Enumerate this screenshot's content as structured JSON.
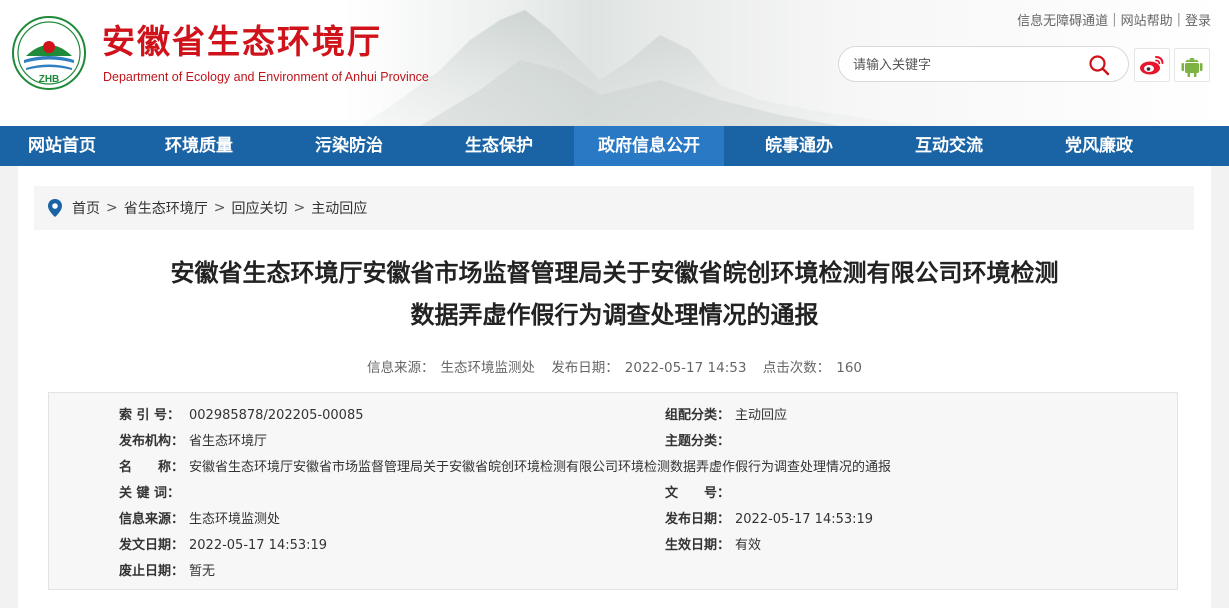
{
  "header": {
    "title": "安徽省生态环境厅",
    "subtitle": "Department of Ecology and Environment of Anhui Province",
    "logo_text": "ZHB",
    "top_links": [
      "信息无障碍通道",
      "网站帮助",
      "登录"
    ],
    "search_placeholder": "请输入关键字",
    "social": [
      "weibo-icon",
      "android-icon"
    ]
  },
  "nav": {
    "items": [
      "网站首页",
      "环境质量",
      "污染防治",
      "生态保护",
      "政府信息公开",
      "皖事通办",
      "互动交流",
      "党风廉政"
    ],
    "active_index": 4
  },
  "breadcrumb": [
    "首页",
    "省生态环境厅",
    "回应关切",
    "主动回应"
  ],
  "article": {
    "title_line1": "安徽省生态环境厅安徽省市场监督管理局关于安徽省皖创环境检测有限公司环境检测",
    "title_line2": "数据弄虚作假行为调查处理情况的通报",
    "source_label": "信息来源：",
    "source": "生态环境监测处",
    "date_label": "发布日期：",
    "date": "2022-05-17 14:53",
    "views_label": "点击次数：",
    "views": "160"
  },
  "info": {
    "index_label": "索 引 号：",
    "index_value": "002985878/202205-00085",
    "category_label": "组配分类：",
    "category_value": "主动回应",
    "publisher_label": "发布机构：",
    "publisher_value": "省生态环境厅",
    "topic_label": "主题分类：",
    "topic_value": "",
    "name_label": "名　　称：",
    "name_value": "安徽省生态环境厅安徽省市场监督管理局关于安徽省皖创环境检测有限公司环境检测数据弄虚作假行为调查处理情况的通报",
    "keywords_label": "关 键 词：",
    "keywords_value": "",
    "docno_label": "文　　号：",
    "docno_value": "",
    "source_label": "信息来源：",
    "source_value": "生态环境监测处",
    "pubdate_label": "发布日期：",
    "pubdate_value": "2022-05-17 14:53:19",
    "issuedate_label": "发文日期：",
    "issuedate_value": "2022-05-17 14:53:19",
    "effective_label": "生效日期：",
    "effective_value": "有效",
    "expiry_label": "废止日期：",
    "expiry_value": "暂无"
  },
  "colors": {
    "brand_red": "#d0131b",
    "nav_blue": "#1a64a6",
    "nav_active": "#2979c4"
  }
}
